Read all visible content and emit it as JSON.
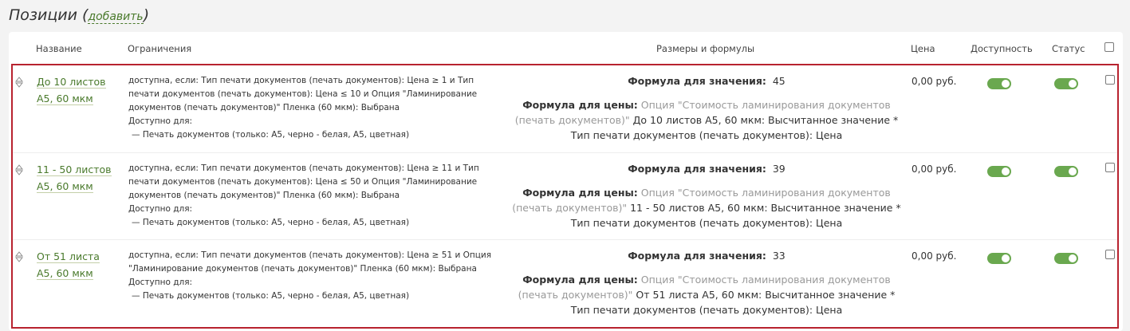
{
  "title": "Позиции",
  "add_label": "добавить",
  "headers": {
    "name": "Название",
    "constraints": "Ограничения",
    "formulas": "Размеры и формулы",
    "price": "Цена",
    "availability": "Доступность",
    "status": "Статус"
  },
  "rows": [
    {
      "name_line1": "До 10 листов",
      "name_line2": "А5, 60 мкм",
      "cons": [
        "доступна, если: Тип печати документов (печать документов): Цена ≥ 1 и Тип",
        "печати документов (печать документов): Цена ≤ 10 и Опция \"Ламинирование",
        "документов (печать документов)\" Пленка (60 мкм): Выбрана",
        "Доступно для:",
        "  — Печать документов (только: А5, черно - белая, А5, цветная)"
      ],
      "value_label": "Формула для значения:",
      "value": "45",
      "price_label": "Формула для цены:",
      "price_formula_grey1": "Опция \"Стоимость ламинирования документов",
      "price_formula_grey2": "(печать документов)\"",
      "price_formula_rest": "До 10 листов А5, 60 мкм: Высчитанное значение *",
      "price_formula_line3": "Тип печати документов (печать документов): Цена",
      "price": "0,00 руб."
    },
    {
      "name_line1": "11 - 50 листов",
      "name_line2": "А5, 60 мкм",
      "cons": [
        "доступна, если: Тип печати документов (печать документов): Цена ≥ 11 и Тип",
        "печати документов (печать документов): Цена ≤ 50 и Опция \"Ламинирование",
        "документов (печать документов)\" Пленка (60 мкм): Выбрана",
        "Доступно для:",
        "  — Печать документов (только: А5, черно - белая, А5, цветная)"
      ],
      "value_label": "Формула для значения:",
      "value": "39",
      "price_label": "Формула для цены:",
      "price_formula_grey1": "Опция \"Стоимость ламинирования документов",
      "price_formula_grey2": "(печать документов)\"",
      "price_formula_rest": "11 - 50 листов А5, 60 мкм: Высчитанное значение *",
      "price_formula_line3": "Тип печати документов (печать документов): Цена",
      "price": "0,00 руб."
    },
    {
      "name_line1": "От 51 листа",
      "name_line2": "А5, 60 мкм",
      "cons": [
        "доступна, если: Тип печати документов (печать документов): Цена ≥ 51 и Опция",
        "\"Ламинирование документов (печать документов)\" Пленка (60 мкм): Выбрана",
        "Доступно для:",
        "  — Печать документов (только: А5, черно - белая, А5, цветная)"
      ],
      "value_label": "Формула для значения:",
      "value": "33",
      "price_label": "Формула для цены:",
      "price_formula_grey1": "Опция \"Стоимость ламинирования документов",
      "price_formula_grey2": "(печать документов)\"",
      "price_formula_rest": "От 51 листа А5, 60 мкм: Высчитанное значение *",
      "price_formula_line3": "Тип печати документов (печать документов): Цена",
      "price": "0,00 руб."
    }
  ],
  "toggle_on_color": "#6aa84f",
  "accent_link_color": "#4a7a2c",
  "selection_border_color": "#b8232f"
}
